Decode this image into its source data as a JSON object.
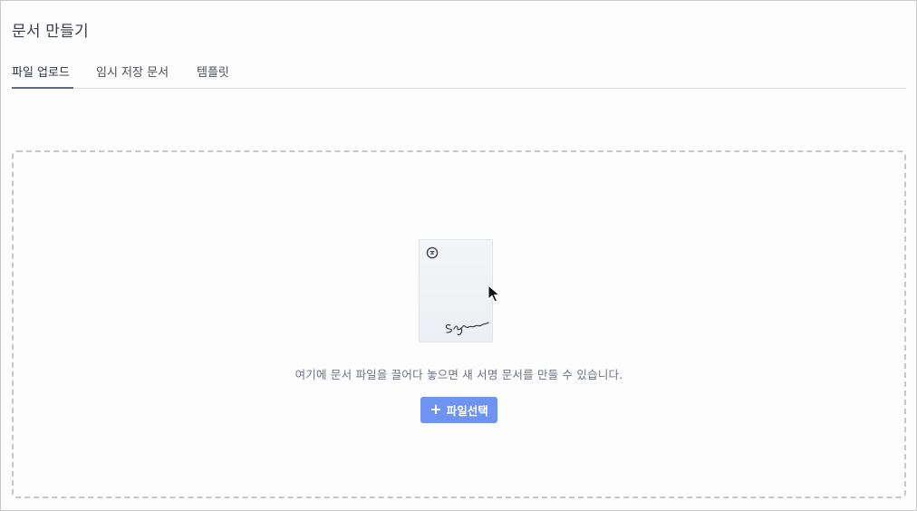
{
  "page": {
    "title": "문서 만들기"
  },
  "tabs": [
    {
      "label": "파일 업로드",
      "active": true
    },
    {
      "label": "임시 저장 문서",
      "active": false
    },
    {
      "label": "템플릿",
      "active": false
    }
  ],
  "dropzone": {
    "message": "여기에 문서 파일을 끌어다 놓으면 새 서명 문서를 만들 수 있습니다.",
    "button_label": "파일선택",
    "button_icon": "plus-icon",
    "illustration_signature_text": "Signature"
  },
  "colors": {
    "accent_button": "#6e93f0",
    "tab_active_underline": "#5f6b83",
    "dashed_border": "#c4c7cc"
  }
}
